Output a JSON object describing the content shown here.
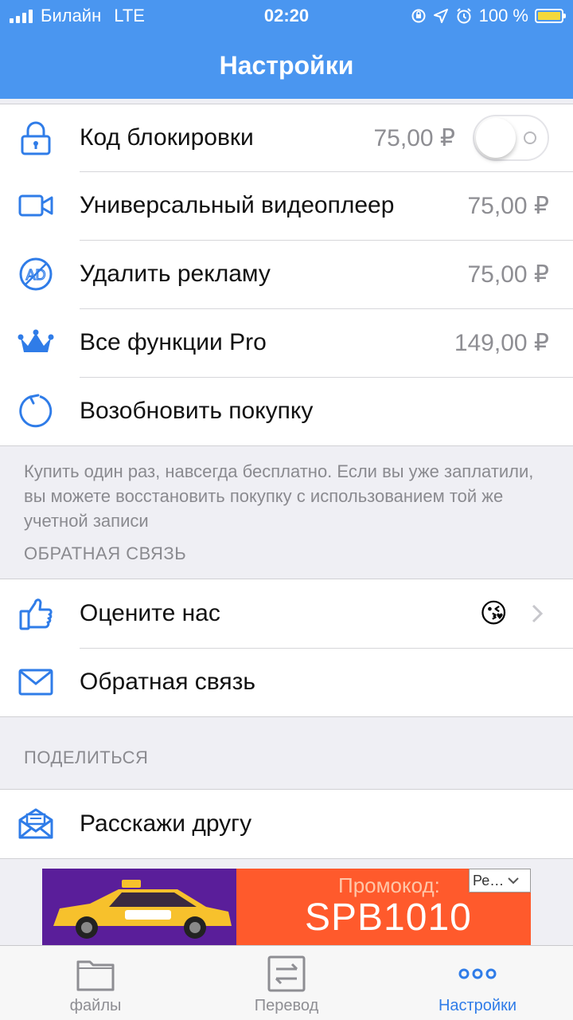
{
  "status_bar": {
    "carrier": "Билайн",
    "network": "LTE",
    "time": "02:20",
    "battery": "100 %"
  },
  "nav": {
    "title": "Настройки"
  },
  "purchases": [
    {
      "icon": "lock-icon",
      "label": "Код блокировки",
      "price": "75,00 ₽",
      "toggle_on": false
    },
    {
      "icon": "video-camera-icon",
      "label": "Универсальный видеоплеер",
      "price": "75,00 ₽"
    },
    {
      "icon": "no-ads-icon",
      "label": "Удалить рекламу",
      "price": "75,00 ₽"
    },
    {
      "icon": "crown-icon",
      "label": "Все функции Pro",
      "price": "149,00 ₽"
    },
    {
      "icon": "restore-icon",
      "label": "Возобновить покупку"
    }
  ],
  "purchase_note": "Купить один раз, навсегда бесплатно. Если вы уже заплатили, вы можете восстановить покупку с использованием той же учетной записи",
  "feedback": {
    "header": "ОБРАТНАЯ СВЯЗЬ",
    "rate_label": "Оцените нас",
    "rate_emoji": "😘",
    "feedback_label": "Обратная связь"
  },
  "share": {
    "header": "ПОДЕЛИТЬСЯ",
    "tell_friend_label": "Расскажи другу"
  },
  "ad": {
    "promo_label": "Промокод:",
    "promo_code": "SPB1010",
    "select_text": "Ре…"
  },
  "tabs": [
    {
      "label": "файлы",
      "icon": "folder-icon",
      "active": false
    },
    {
      "label": "Перевод",
      "icon": "transfer-icon",
      "active": false
    },
    {
      "label": "Настройки",
      "icon": "more-dots-icon",
      "active": true
    }
  ],
  "colors": {
    "accent": "#4a96f0",
    "active_tab": "#2f7ce8",
    "icon": "#2f7ce8",
    "secondary_text": "#8e8e93"
  }
}
